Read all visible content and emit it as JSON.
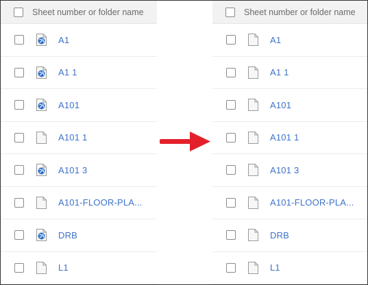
{
  "colors": {
    "link": "#3d72c9",
    "header_bg": "#f2f2f2",
    "arrow": "#e3202a",
    "globe": "#2f6fc6"
  },
  "left_panel": {
    "header_label": "Sheet number or folder name",
    "rows": [
      {
        "label": "A1",
        "icon": "globe-doc-icon"
      },
      {
        "label": "A1 1",
        "icon": "globe-doc-icon"
      },
      {
        "label": "A101",
        "icon": "globe-doc-icon"
      },
      {
        "label": "A101 1",
        "icon": "doc-icon"
      },
      {
        "label": "A101 3",
        "icon": "globe-doc-icon"
      },
      {
        "label": "A101-FLOOR-PLA...",
        "icon": "doc-icon"
      },
      {
        "label": "DRB",
        "icon": "globe-doc-icon"
      },
      {
        "label": "L1",
        "icon": "doc-icon"
      }
    ]
  },
  "right_panel": {
    "header_label": "Sheet number or folder name",
    "rows": [
      {
        "label": "A1",
        "icon": "doc-icon"
      },
      {
        "label": "A1 1",
        "icon": "doc-icon"
      },
      {
        "label": "A101",
        "icon": "doc-icon"
      },
      {
        "label": "A101 1",
        "icon": "doc-icon"
      },
      {
        "label": "A101 3",
        "icon": "doc-icon"
      },
      {
        "label": "A101-FLOOR-PLA...",
        "icon": "doc-icon"
      },
      {
        "label": "DRB",
        "icon": "doc-icon"
      },
      {
        "label": "L1",
        "icon": "doc-icon"
      }
    ]
  }
}
